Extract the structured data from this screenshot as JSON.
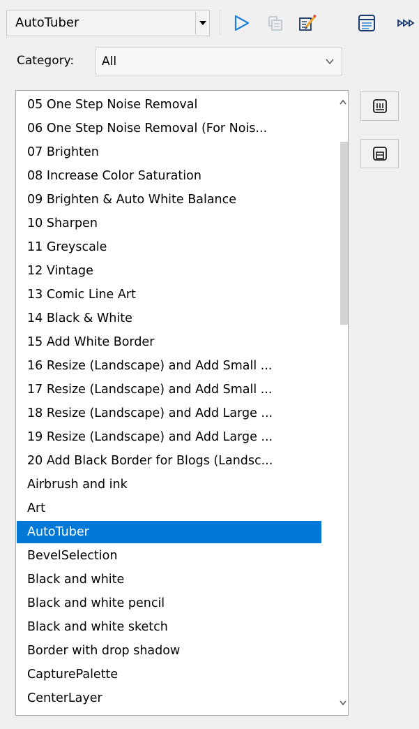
{
  "toolbar": {
    "script_name": "AutoTuber",
    "icons": [
      "dropdown-arrow-icon",
      "run-script-icon",
      "copy-script-icon",
      "edit-script-icon",
      "script-output-icon",
      "batch-process-icon"
    ]
  },
  "category": {
    "label": "Category:",
    "selected": "All"
  },
  "scripts": {
    "items": [
      "05 One Step Noise Removal",
      "06 One Step Noise Removal (For Nois...",
      "07 Brighten",
      "08 Increase Color Saturation",
      "09 Brighten & Auto White Balance",
      "10 Sharpen",
      "11 Greyscale",
      "12 Vintage",
      "13 Comic Line Art",
      "14 Black & White",
      "15 Add White Border",
      "16 Resize (Landscape) and Add Small ...",
      "17 Resize (Landscape) and Add Small ...",
      "18 Resize (Landscape) and Add Large ...",
      "19 Resize (Landscape) and Add Large ...",
      "20 Add Black Border for Blogs (Landsc...",
      "Airbrush and ink",
      "Art",
      "AutoTuber",
      "BevelSelection",
      "Black and white",
      "Black and white pencil",
      "Black and white sketch",
      "Border with drop shadow",
      "CapturePalette",
      "CenterLayer"
    ],
    "selected": "AutoTuber"
  },
  "side_buttons": {
    "icons": [
      "save-script-icon",
      "save-as-icon"
    ]
  },
  "colors": {
    "selection": "#0078d7",
    "run_icon": "#1f7fe0",
    "background": "#f0f0f0"
  }
}
